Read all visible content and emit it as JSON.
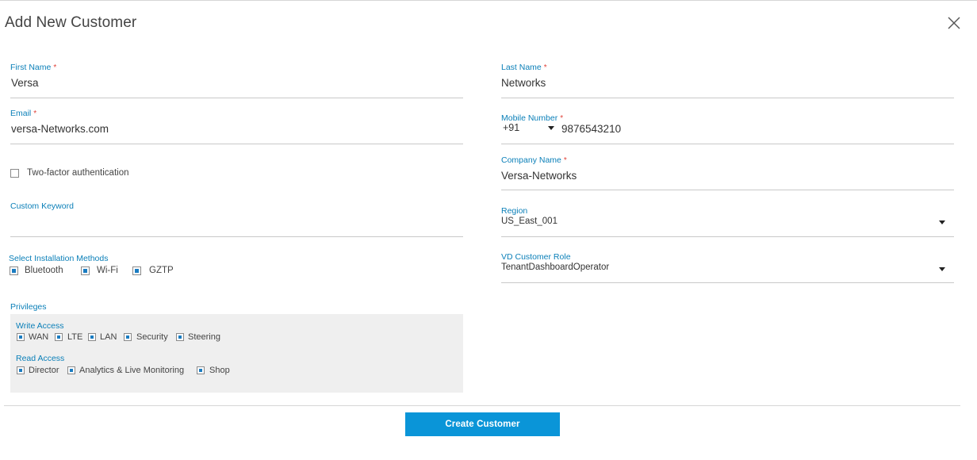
{
  "dialog": {
    "title": "Add New Customer"
  },
  "left": {
    "first_name": {
      "label": "First Name",
      "required": "*",
      "value": "Versa"
    },
    "email": {
      "label": "Email",
      "required": "*",
      "value": "versa-Networks.com"
    },
    "two_factor": {
      "label": "Two-factor authentication",
      "checked": false
    },
    "custom_keyword": {
      "label": "Custom Keyword",
      "value": ""
    },
    "installation": {
      "label": "Select Installation Methods",
      "options": [
        {
          "label": "Bluetooth",
          "checked": true
        },
        {
          "label": "Wi-Fi",
          "checked": true
        },
        {
          "label": "GZTP",
          "checked": true
        }
      ]
    },
    "privileges": {
      "label": "Privileges",
      "write_access": {
        "label": "Write Access",
        "options": [
          {
            "label": "WAN",
            "checked": true
          },
          {
            "label": "LTE",
            "checked": true
          },
          {
            "label": "LAN",
            "checked": true
          },
          {
            "label": "Security",
            "checked": true
          },
          {
            "label": "Steering",
            "checked": true
          }
        ]
      },
      "read_access": {
        "label": "Read Access",
        "options": [
          {
            "label": "Director",
            "checked": true
          },
          {
            "label": "Analytics & Live Monitoring",
            "checked": true
          },
          {
            "label": "Shop",
            "checked": true
          }
        ]
      }
    }
  },
  "right": {
    "last_name": {
      "label": "Last Name",
      "required": "*",
      "value": "Networks"
    },
    "mobile": {
      "label": "Mobile Number",
      "required": "*",
      "country_code": "+91",
      "value": "9876543210"
    },
    "company": {
      "label": "Company Name",
      "required": "*",
      "value": "Versa-Networks"
    },
    "region": {
      "label": "Region",
      "value": "US_East_001"
    },
    "vd_role": {
      "label": "VD Customer Role",
      "value": "TenantDashboardOperator"
    }
  },
  "footer": {
    "create_label": "Create Customer"
  },
  "colors": {
    "accent": "#0a95d8",
    "label": "#0a7fb8",
    "required": "#e0433a",
    "checkbox_fill": "#1a7cc1",
    "privileges_bg": "#efefef"
  }
}
